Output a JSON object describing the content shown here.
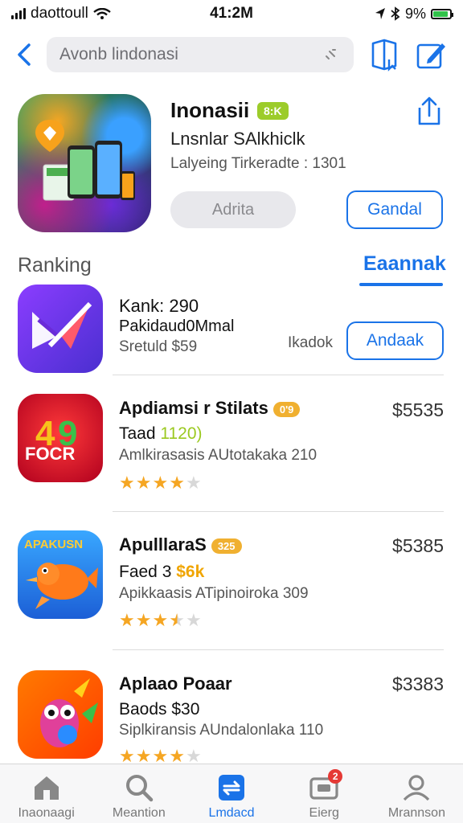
{
  "status_bar": {
    "carrier": "daottoull",
    "time": "41:2M",
    "battery": "9%",
    "battery_level": 0.9
  },
  "nav": {
    "search_text": "Avonb lindonasi",
    "search_placeholder": "Avonb lindonasi"
  },
  "hero": {
    "title": "Inonasii",
    "badge": "8:K",
    "subtitle": "Lnsnlar SAlkhiclk",
    "meta": "Lalyeing Tirkeradte : 1301",
    "secondary_button": "Adrita",
    "primary_button": "Gandal"
  },
  "section": {
    "title": "Ranking",
    "link": "Eaannak"
  },
  "apps": [
    {
      "title": "Kank: 290",
      "line2": "Pakidaud0Mmal",
      "line3": "Sretuld $59",
      "side_label": "Ikadok",
      "button": "Andaak"
    },
    {
      "title": "Apdiamsi r Stilats",
      "badge": "0'9",
      "line2_prefix": "Taad ",
      "line2_highlight": "1120)",
      "line3": "Amlkirasasis AUtotakaka 210",
      "price": "$5535",
      "rating": 4,
      "rating_max": 5
    },
    {
      "title": "ApulllaraS",
      "badge": "325",
      "line2_prefix": "Faed 3 ",
      "line2_highlight": "$6k",
      "line3": "Apikkaasis ATipinoiroka 309",
      "price": "$5385",
      "rating": 3.5,
      "rating_max": 5
    },
    {
      "title": "Aplaao Poaar",
      "line2": "Baods $30",
      "line3": "Siplkiransis AUndalonlaka 110",
      "price": "$3383",
      "rating": 4,
      "rating_max": 5
    }
  ],
  "tabs": [
    {
      "label": "Inaonaagi",
      "icon": "home-icon"
    },
    {
      "label": "Meantion",
      "icon": "search-icon"
    },
    {
      "label": "Lmdacd",
      "icon": "apps-icon",
      "active": true
    },
    {
      "label": "Eierg",
      "icon": "inbox-icon",
      "badge": "2"
    },
    {
      "label": "Mrannson",
      "icon": "person-icon"
    }
  ],
  "colors": {
    "accent": "#1a73e8",
    "star": "#f5a623",
    "badge_green": "#9ccc2a",
    "badge_orange": "#f0b030"
  }
}
